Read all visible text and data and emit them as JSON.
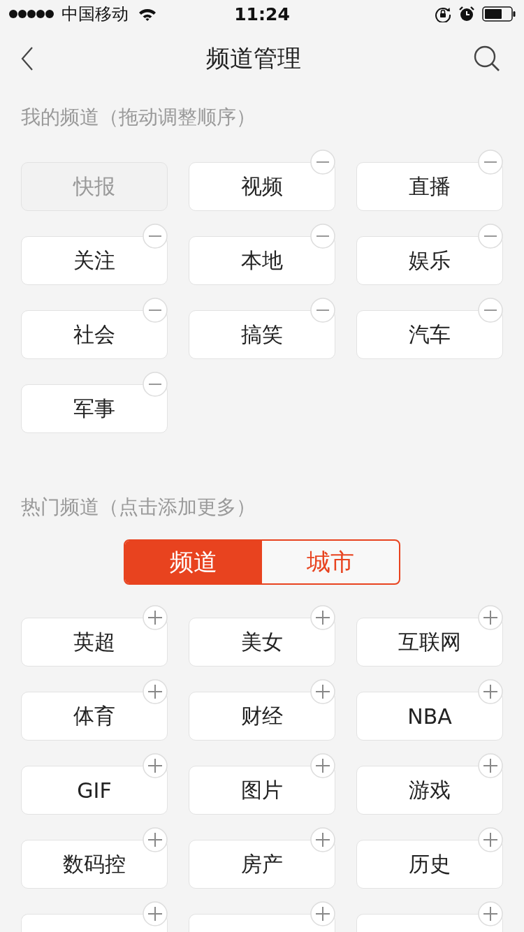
{
  "status_bar": {
    "carrier": "中国移动",
    "time": "11:24"
  },
  "nav": {
    "title": "频道管理"
  },
  "my_channels": {
    "title": "我的频道（拖动调整顺序）",
    "items": [
      {
        "label": "快报",
        "fixed": true
      },
      {
        "label": "视频",
        "fixed": false
      },
      {
        "label": "直播",
        "fixed": false
      },
      {
        "label": "关注",
        "fixed": false
      },
      {
        "label": "本地",
        "fixed": false
      },
      {
        "label": "娱乐",
        "fixed": false
      },
      {
        "label": "社会",
        "fixed": false
      },
      {
        "label": "搞笑",
        "fixed": false
      },
      {
        "label": "汽车",
        "fixed": false
      },
      {
        "label": "军事",
        "fixed": false
      }
    ]
  },
  "hot_channels": {
    "title": "热门频道（点击添加更多）",
    "tabs": [
      {
        "label": "频道",
        "selected": true
      },
      {
        "label": "城市",
        "selected": false
      }
    ],
    "items": [
      {
        "label": "英超"
      },
      {
        "label": "美女"
      },
      {
        "label": "互联网"
      },
      {
        "label": "体育"
      },
      {
        "label": "财经"
      },
      {
        "label": "NBA"
      },
      {
        "label": "GIF"
      },
      {
        "label": "图片"
      },
      {
        "label": "游戏"
      },
      {
        "label": "数码控"
      },
      {
        "label": "房产"
      },
      {
        "label": "历史"
      },
      {
        "cut_off": true
      },
      {
        "cut_off": true
      },
      {
        "cut_off": true
      }
    ]
  }
}
